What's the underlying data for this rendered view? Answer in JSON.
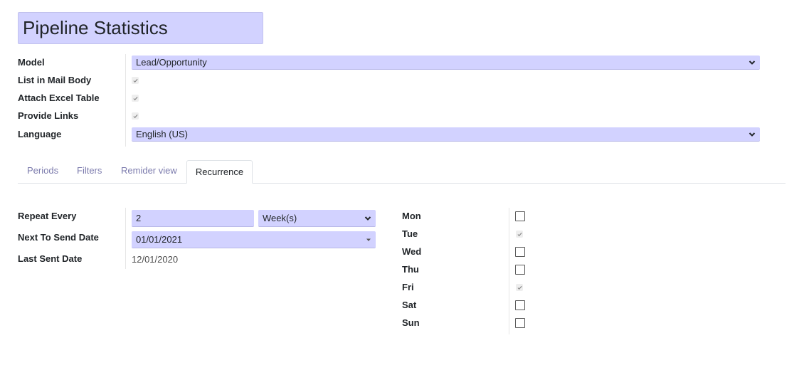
{
  "title": "Pipeline Statistics",
  "fields": {
    "model": {
      "label": "Model",
      "value": "Lead/Opportunity"
    },
    "list_in_mail_body": {
      "label": "List in Mail Body",
      "checked": true
    },
    "attach_excel_table": {
      "label": "Attach Excel Table",
      "checked": true
    },
    "provide_links": {
      "label": "Provide Links",
      "checked": true
    },
    "language": {
      "label": "Language",
      "value": "English (US)"
    }
  },
  "tabs": [
    {
      "label": "Periods",
      "active": false
    },
    {
      "label": "Filters",
      "active": false
    },
    {
      "label": "Remider view",
      "active": false
    },
    {
      "label": "Recurrence",
      "active": true
    }
  ],
  "recurrence": {
    "repeat_every": {
      "label": "Repeat Every",
      "value": "2",
      "unit": "Week(s)"
    },
    "next_to_send_date": {
      "label": "Next To Send Date",
      "value": "01/01/2021"
    },
    "last_sent_date": {
      "label": "Last Sent Date",
      "value": "12/01/2020"
    },
    "days": [
      {
        "label": "Mon",
        "checked": false
      },
      {
        "label": "Tue",
        "checked": true
      },
      {
        "label": "Wed",
        "checked": false
      },
      {
        "label": "Thu",
        "checked": false
      },
      {
        "label": "Fri",
        "checked": true
      },
      {
        "label": "Sat",
        "checked": false
      },
      {
        "label": "Sun",
        "checked": false
      }
    ]
  }
}
